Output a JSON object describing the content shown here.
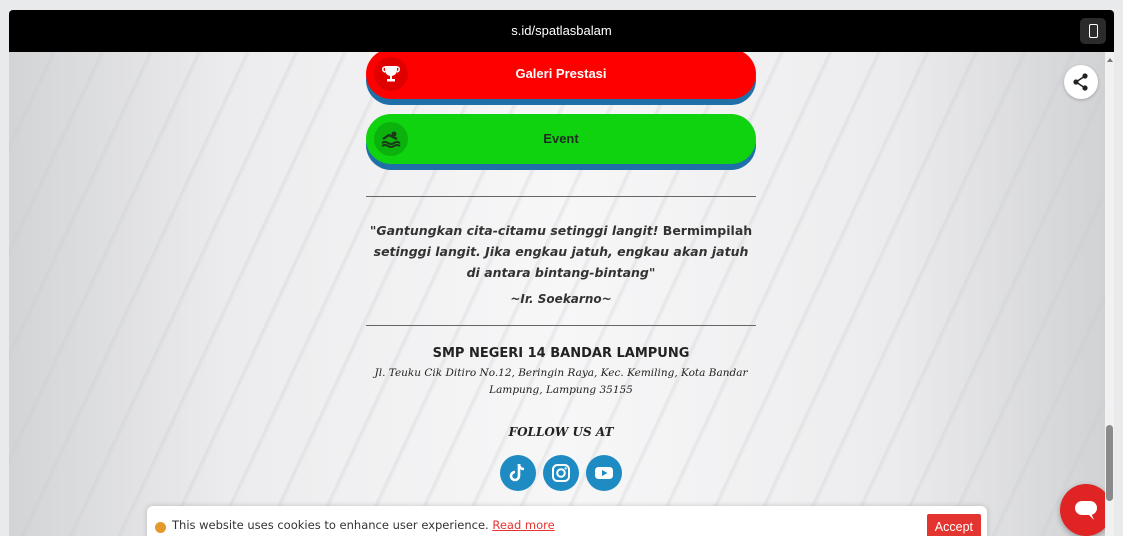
{
  "browser": {
    "url": "s.id/spatlasbalam"
  },
  "buttons": [
    {
      "label": "Galeri Prestasi",
      "icon": "trophy-icon",
      "color": "#ff0000"
    },
    {
      "label": "Event",
      "icon": "swimmer-icon",
      "color": "#0ed30e"
    }
  ],
  "quote": {
    "open": "\"",
    "part1": "Gantungkan cita-citamu setinggi langit!",
    "part2": " Bermimpilah ",
    "part3": "setinggi langit. Jika engkau jatuh, engkau akan jatuh di antara bintang-bintang",
    "close": "\"",
    "author": "~Ir. Soekarno~"
  },
  "footer": {
    "school": "SMP NEGERI 14 BANDAR LAMPUNG",
    "address": "Jl. Teuku Cik Ditiro No.12, Beringin Raya, Kec. Kemiling, Kota Bandar Lampung, Lampung 35155",
    "follow": "FOLLOW US AT",
    "socials": [
      "tiktok-icon",
      "instagram-icon",
      "youtube-icon"
    ]
  },
  "cookie": {
    "text": "This website uses cookies to enhance user experience. ",
    "link": "Read more",
    "accept": "Accept"
  },
  "colors": {
    "accent_blue": "#1e8bc3",
    "cookie_red": "#e3342f"
  }
}
